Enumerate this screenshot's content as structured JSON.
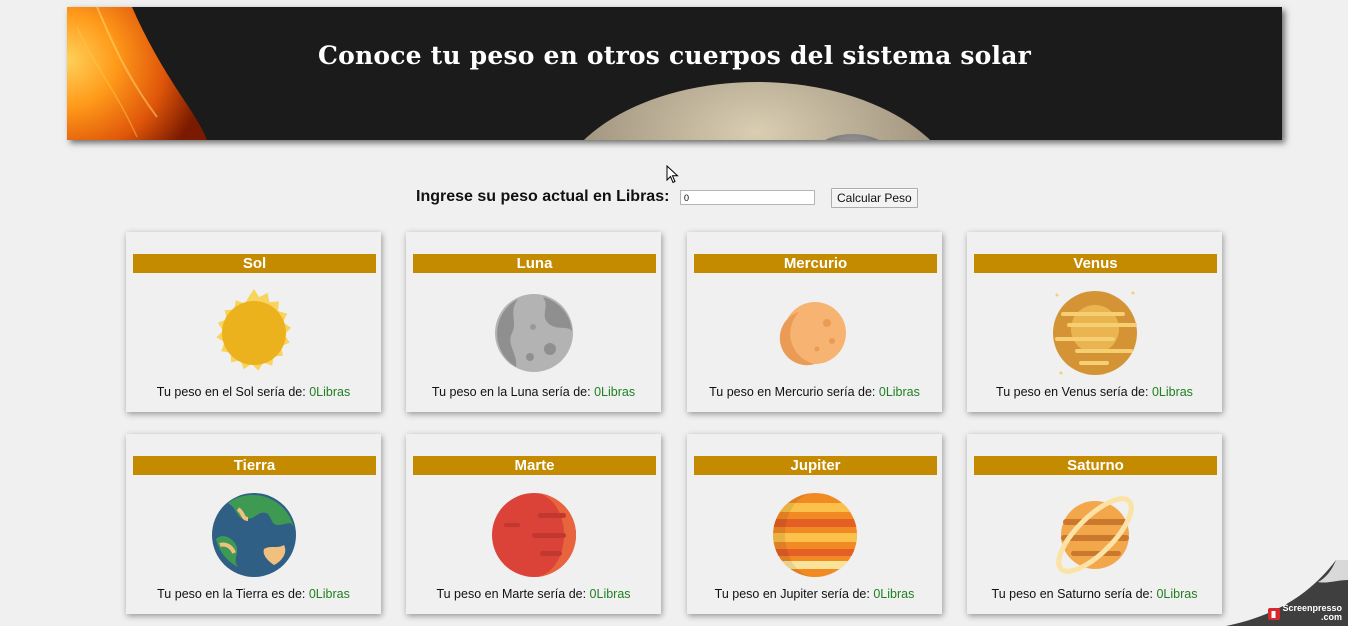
{
  "banner": {
    "title": "Conoce tu peso en otros cuerpos del sistema solar"
  },
  "form": {
    "label": "Ingrese su peso actual en Libras:",
    "input_value": "0",
    "button_label": "Calcular Peso"
  },
  "cards": [
    {
      "name": "Sol",
      "icon": "sun-icon",
      "text": "Tu peso en el Sol sería de: ",
      "value": "0Libras"
    },
    {
      "name": "Luna",
      "icon": "moon-icon",
      "text": "Tu peso en la Luna sería de: ",
      "value": "0Libras"
    },
    {
      "name": "Mercurio",
      "icon": "mercury-icon",
      "text": "Tu peso en Mercurio sería de: ",
      "value": "0Libras"
    },
    {
      "name": "Venus",
      "icon": "venus-icon",
      "text": "Tu peso en Venus sería de: ",
      "value": "0Libras"
    },
    {
      "name": "Tierra",
      "icon": "earth-icon",
      "text": "Tu peso en la Tierra es de: ",
      "value": "0Libras"
    },
    {
      "name": "Marte",
      "icon": "mars-icon",
      "text": "Tu peso en Marte sería de: ",
      "value": "0Libras"
    },
    {
      "name": "Jupiter",
      "icon": "jupiter-icon",
      "text": "Tu peso en Jupiter sería de: ",
      "value": "0Libras"
    },
    {
      "name": "Saturno",
      "icon": "saturn-icon",
      "text": "Tu peso en Saturno sería de: ",
      "value": "0Libras"
    }
  ],
  "watermark": {
    "line1": "Screenpresso",
    "line2": ".com"
  },
  "colors": {
    "accent": "#c58b00",
    "value_green": "#208020",
    "banner_bg": "#1b1b1b"
  }
}
